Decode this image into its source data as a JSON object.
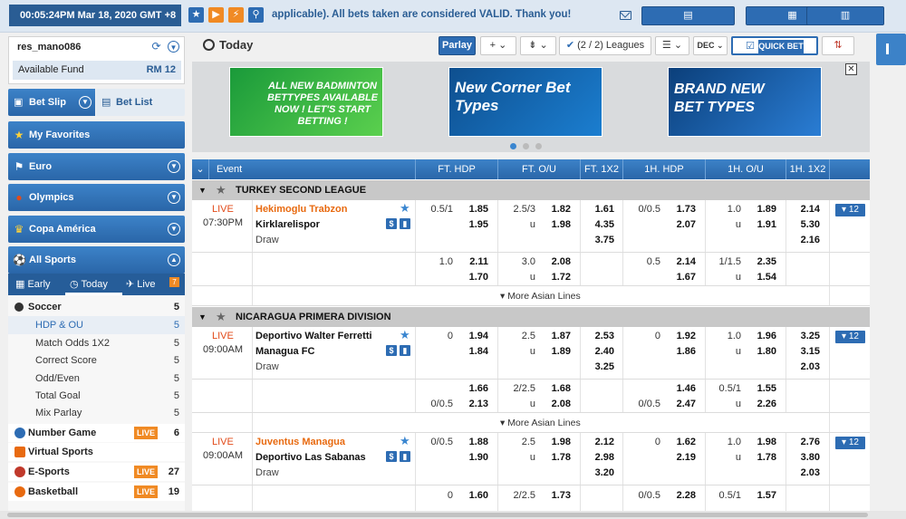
{
  "topbar": {
    "clock": "00:05:24PM Mar 18, 2020 GMT +8",
    "marquee": "applicable). All bets taken are considered VALID. Thank you!",
    "icons": [
      "star-icon",
      "play-icon",
      "running-man-icon",
      "search-icon"
    ]
  },
  "user": {
    "name": "res_mano086",
    "fund_label": "Available Fund",
    "fund_value": "RM 12"
  },
  "nav": {
    "bet_slip": "Bet Slip",
    "bet_list": "Bet List",
    "favorites": "My Favorites",
    "euro": "Euro",
    "olympics": "Olympics",
    "copa": "Copa América",
    "all_sports": "All Sports"
  },
  "tabs": {
    "early": "Early",
    "today": "Today",
    "live": "Live",
    "live_badge": "7"
  },
  "sports": [
    {
      "label": "Soccer",
      "count": "5"
    },
    {
      "label": "HDP & OU",
      "count": "5"
    },
    {
      "label": "Match Odds 1X2",
      "count": "5"
    },
    {
      "label": "Correct Score",
      "count": "5"
    },
    {
      "label": "Odd/Even",
      "count": "5"
    },
    {
      "label": "Total Goal",
      "count": "5"
    },
    {
      "label": "Mix Parlay",
      "count": "5"
    },
    {
      "label": "Number Game",
      "count": "6",
      "badge": "LIVE"
    },
    {
      "label": "Virtual Sports",
      "count": ""
    },
    {
      "label": "E-Sports",
      "count": "27",
      "badge": "LIVE"
    },
    {
      "label": "Basketball",
      "count": "19",
      "badge": "LIVE"
    }
  ],
  "main": {
    "title": "Today",
    "parlay": "Parlay",
    "leagues": "(2 / 2) Leagues",
    "quick_bet": "QUICK BET",
    "dec": "DEC"
  },
  "banners": [
    "ALL NEW BADMINTON BETTYPES AVAILABLE NOW ! LET'S START BETTING !",
    "New Corner Bet Types",
    "BRAND NEW BET TYPES"
  ],
  "columns": [
    "Event",
    "FT. HDP",
    "FT. O/U",
    "FT. 1X2",
    "1H. HDP",
    "1H. O/U",
    "1H. 1X2"
  ],
  "more_asian": "▾ More Asian Lines",
  "leagues": [
    {
      "name": "TURKEY SECOND LEAGUE",
      "match": {
        "status": "LIVE",
        "time": "07:30PM",
        "home": "Hekimoglu Trabzon",
        "away": "Kirklarelispor",
        "draw": "Draw",
        "more": "▾ 12",
        "r1": {
          "fthdp": "0.5/1",
          "fth1": "1.85",
          "fth2": "1.95",
          "ftou": "2.5/3",
          "fto1": "1.82",
          "fto2": "1.98",
          "x1": "1.61",
          "x2": "4.35",
          "x3": "3.75",
          "hhdp": "0/0.5",
          "hh1": "1.73",
          "hh2": "2.07",
          "hou": "1.0",
          "ho1": "1.89",
          "ho2": "1.91",
          "hx1": "2.14",
          "hx2": "5.30",
          "hx3": "2.16"
        },
        "r2": {
          "fthdp": "1.0",
          "fth1": "2.11",
          "fth2": "1.70",
          "ftou": "3.0",
          "fto1": "2.08",
          "fto2": "1.72",
          "hhdp": "0.5",
          "hh1": "2.14",
          "hh2": "1.67",
          "hou": "1/1.5",
          "ho1": "2.35",
          "ho2": "1.54"
        }
      }
    },
    {
      "name": "NICARAGUA PRIMERA DIVISION",
      "match": {
        "status": "LIVE",
        "time": "09:00AM",
        "home": "Deportivo Walter Ferretti",
        "away": "Managua FC",
        "draw": "Draw",
        "more": "▾ 12",
        "r1": {
          "fthdp": "0",
          "fth1": "1.94",
          "fth2": "1.84",
          "ftou": "2.5",
          "fto1": "1.87",
          "fto2": "1.89",
          "x1": "2.53",
          "x2": "2.40",
          "x3": "3.25",
          "hhdp": "0",
          "hh1": "1.92",
          "hh2": "1.86",
          "hou": "1.0",
          "ho1": "1.96",
          "ho2": "1.80",
          "hx1": "3.25",
          "hx2": "3.15",
          "hx3": "2.03"
        },
        "r2": {
          "fthdp": "0/0.5",
          "fth1": "1.66",
          "fth2": "2.13",
          "ftou": "2/2.5",
          "fto1": "1.68",
          "fto2": "2.08",
          "hhdp": "0/0.5",
          "hh1": "1.46",
          "hh2": "2.47",
          "hou": "0.5/1",
          "ho1": "1.55",
          "ho2": "2.26"
        }
      },
      "match2": {
        "status": "LIVE",
        "time": "09:00AM",
        "home": "Juventus Managua",
        "away": "Deportivo Las Sabanas",
        "draw": "Draw",
        "more": "▾ 12",
        "r1": {
          "fthdp": "0/0.5",
          "fth1": "1.88",
          "fth2": "1.90",
          "ftou": "2.5",
          "fto1": "1.98",
          "fto2": "1.78",
          "x1": "2.12",
          "x2": "2.98",
          "x3": "3.20",
          "hhdp": "0",
          "hh1": "1.62",
          "hh2": "2.19",
          "hou": "1.0",
          "ho1": "1.98",
          "ho2": "1.78",
          "hx1": "2.76",
          "hx2": "3.80",
          "hx3": "2.03"
        },
        "r2": {
          "fthdp": "0",
          "fth1": "1.60",
          "ftou": "2/2.5",
          "fto1": "1.73",
          "hhdp": "0/0.5",
          "hh1": "2.28",
          "hou": "0.5/1",
          "ho1": "1.57"
        }
      }
    }
  ]
}
